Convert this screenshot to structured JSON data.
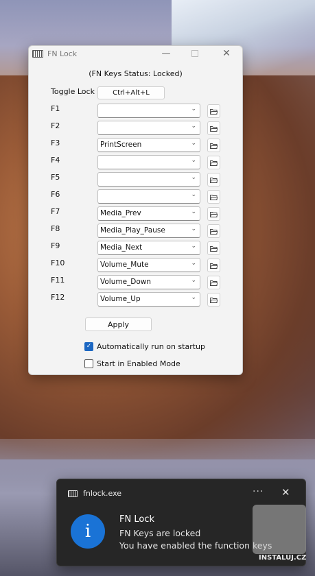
{
  "window": {
    "title": "FN Lock",
    "minimize": "—",
    "close": "✕",
    "status": "(FN Keys Status: Locked)",
    "toggle_label": "Toggle Lock",
    "toggle_hotkey": "Ctrl+Alt+L",
    "rows": [
      {
        "key": "F1",
        "value": ""
      },
      {
        "key": "F2",
        "value": ""
      },
      {
        "key": "F3",
        "value": "PrintScreen"
      },
      {
        "key": "F4",
        "value": ""
      },
      {
        "key": "F5",
        "value": ""
      },
      {
        "key": "F6",
        "value": ""
      },
      {
        "key": "F7",
        "value": "Media_Prev"
      },
      {
        "key": "F8",
        "value": "Media_Play_Pause"
      },
      {
        "key": "F9",
        "value": "Media_Next"
      },
      {
        "key": "F10",
        "value": "Volume_Mute"
      },
      {
        "key": "F11",
        "value": "Volume_Down"
      },
      {
        "key": "F12",
        "value": "Volume_Up"
      }
    ],
    "apply": "Apply",
    "autorun_label": "Automatically run on startup",
    "autorun_checked": true,
    "enabled_mode_label": "Start in Enabled Mode",
    "enabled_mode_checked": false
  },
  "toast": {
    "app": "fnlock.exe",
    "more": "···",
    "close": "✕",
    "title": "FN Lock",
    "line1": "FN Keys are locked",
    "line2": "You have enabled the function keys",
    "icon": "i"
  },
  "watermark": "INSTALUJ.CZ",
  "colors": {
    "accent": "#1c67c2",
    "info": "#1a73d6",
    "toast_bg": "#262626"
  }
}
